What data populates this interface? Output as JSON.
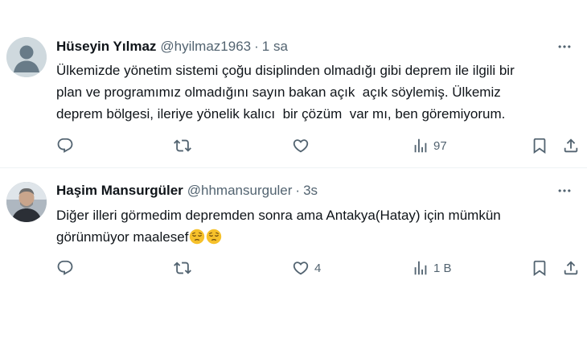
{
  "tweets": [
    {
      "author_name": "Hüseyin Yılmaz",
      "handle": "@hyilmaz1963",
      "separator": "·",
      "time": "1 sa",
      "text": "Ülkemizde yönetim sistemi çoğu disiplinden olmadığı gibi deprem ile ilgili bir\nplan ve programımız olmadığını sayın bakan açık  açık söylemiş. Ülkemiz\ndeprem bölgesi, ileriye yönelik kalıcı  bir çözüm  var mı, ben göremiyorum.",
      "likes": "",
      "views": "97",
      "avatar": "default-avatar"
    },
    {
      "author_name": "Haşim Mansurgüler",
      "handle": "@hhmansurguler",
      "separator": "·",
      "time": "3s",
      "text": "Diğer illeri görmedim depremden sonra ama Antakya(Hatay) için mümkün\ngörünmüyor maalesef",
      "text_emojis": [
        "pensive-face",
        "pensive-face"
      ],
      "likes": "4",
      "views": "1 B",
      "avatar": "profile-photo"
    }
  ],
  "icons": {
    "reply": "reply-icon",
    "retweet": "retweet-icon",
    "like": "heart-icon",
    "views": "views-icon",
    "bookmark": "bookmark-icon",
    "share": "share-icon",
    "more": "more-icon"
  },
  "colors": {
    "text_primary": "#0f1419",
    "text_secondary": "#536471",
    "divider": "#eff3f4"
  }
}
